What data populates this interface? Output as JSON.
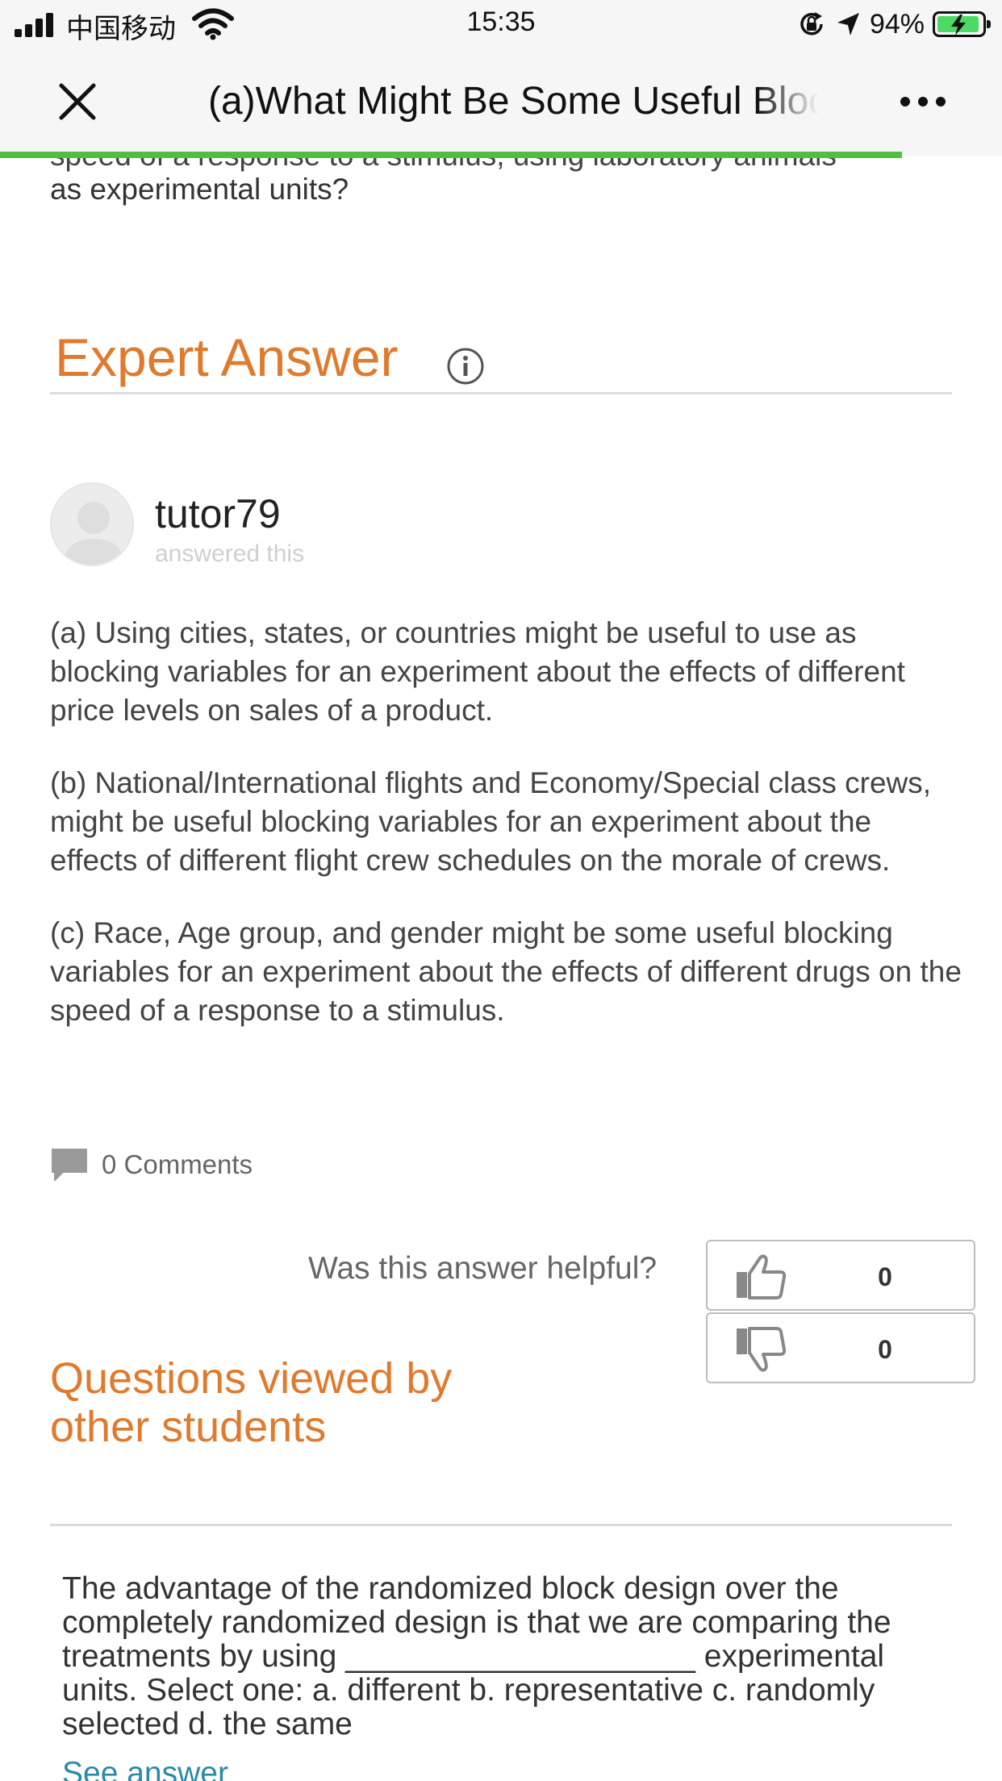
{
  "status_bar": {
    "carrier": "中国移动",
    "time": "15:35",
    "battery_percent": "94%",
    "battery_level": 0.94,
    "battery_color": "#4cd964",
    "icons": [
      "signal-icon",
      "wifi-icon",
      "orientation-lock-icon",
      "location-arrow-icon",
      "battery-icon"
    ]
  },
  "nav": {
    "title": "(a)What Might Be Some Useful Blocking Variables",
    "close_icon": "close-icon",
    "more_icon": "more-icon",
    "load_progress": 0.9,
    "progress_color": "#4fbf40"
  },
  "question": {
    "cut_line": "speed of a response to a stimulus, using laboratory animals",
    "tail": "as experimental units?"
  },
  "expert_answer": {
    "title": "Expert Answer",
    "title_color": "#e07a2c",
    "tutor": "tutor79",
    "answered_label": "answered this",
    "paragraphs": [
      "(a) Using cities, states, or countries might be useful to use as blocking variables for an experiment about the effects of different price levels on sales of a product.",
      "(b) National/International flights and Economy/Special class crews, might be useful blocking variables for an experiment about the effects of different flight crew schedules on the morale of crews.",
      "(c) Race, Age group, and gender might be some useful blocking variables for an experiment about the effects of different drugs on the speed of a response to a stimulus."
    ],
    "comments_label": "0 Comments"
  },
  "feedback": {
    "question": "Was this answer helpful?",
    "thumbs_up_count": "0",
    "thumbs_down_count": "0"
  },
  "related": {
    "heading": "Questions viewed by other students",
    "items": [
      {
        "text": "The advantage of the randomized block design over the completely randomized design is that we are comparing the treatments by using ____________________ experimental units. Select one: a. different b. representative c. randomly selected d. the same",
        "link": "See answer"
      }
    ]
  }
}
